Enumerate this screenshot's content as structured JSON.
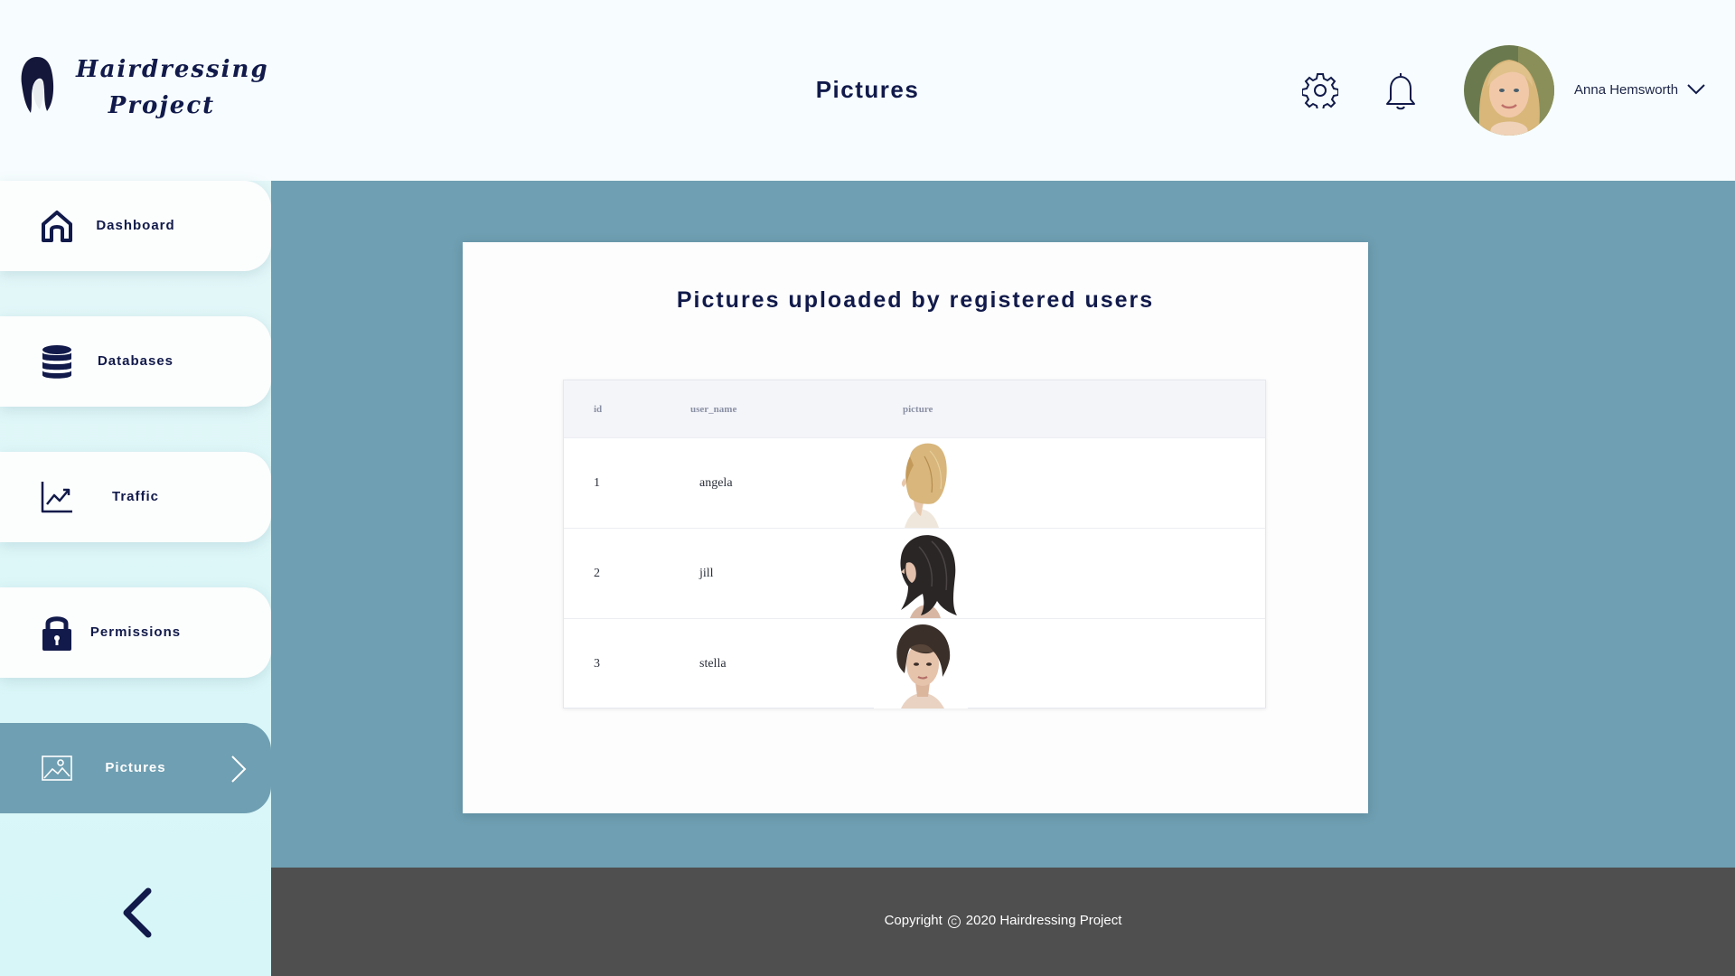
{
  "app": {
    "logo_line1": "Hairdressing",
    "logo_line2": "Project",
    "page_title": "Pictures"
  },
  "header": {
    "user_name": "Anna Hemsworth",
    "settings_icon": "gear-icon",
    "notifications_icon": "bell-icon"
  },
  "sidebar": {
    "items": [
      {
        "label": "Dashboard",
        "icon": "home-icon",
        "active": false
      },
      {
        "label": "Databases",
        "icon": "database-icon",
        "active": false
      },
      {
        "label": "Traffic",
        "icon": "chart-line-icon",
        "active": false
      },
      {
        "label": "Permissions",
        "icon": "lock-icon",
        "active": false
      },
      {
        "label": "Pictures",
        "icon": "image-icon",
        "active": true
      }
    ],
    "collapse_icon": "chevron-left-icon"
  },
  "main": {
    "card_title": "Pictures uploaded by registered users",
    "table": {
      "columns": [
        "id",
        "user_name",
        "picture"
      ],
      "rows": [
        {
          "id": "1",
          "user_name": "angela",
          "picture": "blonde-bob-hair-photo"
        },
        {
          "id": "2",
          "user_name": "jill",
          "picture": "dark-layered-hair-photo"
        },
        {
          "id": "3",
          "user_name": "stella",
          "picture": "brown-short-hair-photo"
        }
      ]
    }
  },
  "footer": {
    "copyright_prefix": "Copyright",
    "copyright_suffix": "2020 Hairdressing Project"
  },
  "colors": {
    "navy": "#111a4a",
    "teal": "#6f9fb2",
    "sidebar_bg": "#d6f6f8",
    "footer_bg": "#4f4f4f"
  }
}
